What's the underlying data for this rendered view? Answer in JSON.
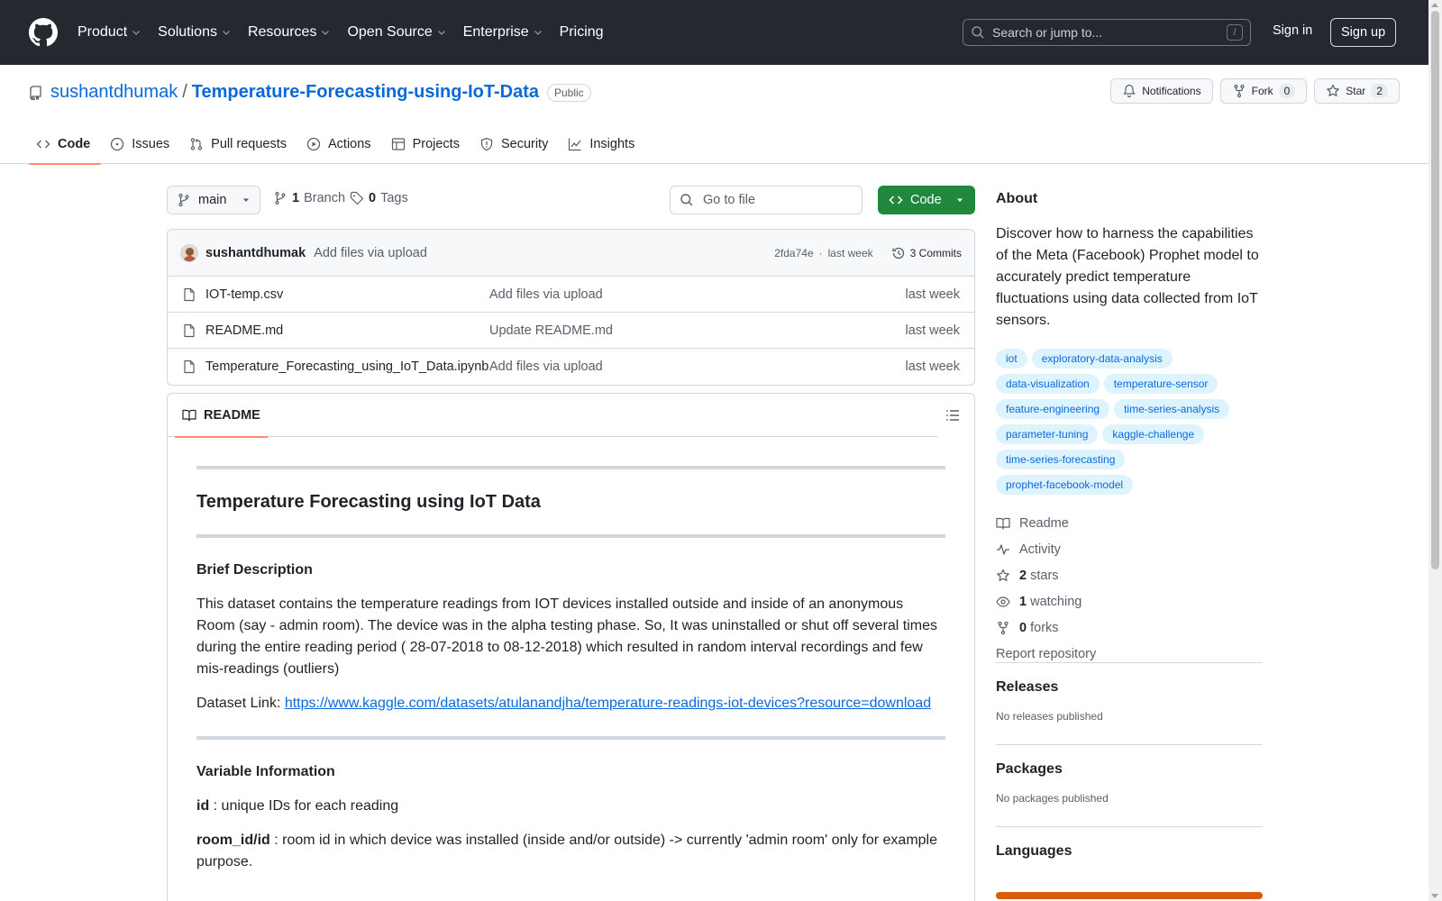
{
  "header": {
    "nav": [
      {
        "label": "Product",
        "dropdown": true
      },
      {
        "label": "Solutions",
        "dropdown": true
      },
      {
        "label": "Resources",
        "dropdown": true
      },
      {
        "label": "Open Source",
        "dropdown": true
      },
      {
        "label": "Enterprise",
        "dropdown": true
      },
      {
        "label": "Pricing",
        "dropdown": false
      }
    ],
    "search_placeholder": "Search or jump to...",
    "search_key": "/",
    "sign_in": "Sign in",
    "sign_up": "Sign up"
  },
  "repo": {
    "owner": "sushantdhumak",
    "separator": "/",
    "name": "Temperature-Forecasting-using-IoT-Data",
    "visibility": "Public",
    "notifications_label": "Notifications",
    "fork_label": "Fork",
    "fork_count": "0",
    "star_label": "Star",
    "star_count": "2"
  },
  "tabs": [
    {
      "label": "Code",
      "icon": "code-icon",
      "active": true
    },
    {
      "label": "Issues",
      "icon": "issue-icon",
      "active": false
    },
    {
      "label": "Pull requests",
      "icon": "pull-request-icon",
      "active": false
    },
    {
      "label": "Actions",
      "icon": "play-icon",
      "active": false
    },
    {
      "label": "Projects",
      "icon": "table-icon",
      "active": false
    },
    {
      "label": "Security",
      "icon": "shield-icon",
      "active": false
    },
    {
      "label": "Insights",
      "icon": "graph-icon",
      "active": false
    }
  ],
  "toolbar": {
    "branch": "main",
    "branch_count": "1",
    "branch_label": "Branch",
    "tag_count": "0",
    "tag_label": "Tags",
    "goto_placeholder": "Go to file",
    "code_button": "Code"
  },
  "commit": {
    "author": "sushantdhumak",
    "message": "Add files via upload",
    "hash": "2fda74e",
    "dot": "·",
    "time": "last week",
    "commits_label": "3 Commits"
  },
  "files": [
    {
      "name": "IOT-temp.csv",
      "message": "Add files via upload",
      "time": "last week"
    },
    {
      "name": "README.md",
      "message": "Update README.md",
      "time": "last week"
    },
    {
      "name": "Temperature_Forecasting_using_IoT_Data.ipynb",
      "message": "Add files via upload",
      "time": "last week"
    }
  ],
  "readme": {
    "tab_label": "README",
    "title": "Temperature Forecasting using IoT Data",
    "brief_heading": "Brief Description",
    "brief_text": "This dataset contains the temperature readings from IOT devices installed outside and inside of an anonymous Room (say - admin room). The device was in the alpha testing phase. So, It was uninstalled or shut off several times during the entire reading period ( 28-07-2018 to 08-12-2018) which resulted in random interval recordings and few mis-readings (outliers)",
    "dataset_label": "Dataset Link: ",
    "dataset_url": "https://www.kaggle.com/datasets/atulanandjha/temperature-readings-iot-devices?resource=download",
    "variable_heading": "Variable Information",
    "var_id_name": "id",
    "var_id_desc": " : unique IDs for each reading",
    "var_room_name": "room_id/id",
    "var_room_desc": " : room id in which device was installed (inside and/or outside) -> currently 'admin room' only for example purpose."
  },
  "about": {
    "heading": "About",
    "description": "Discover how to harness the capabilities of the Meta (Facebook) Prophet model to accurately predict temperature fluctuations using data collected from IoT sensors.",
    "topics": [
      "iot",
      "exploratory-data-analysis",
      "data-visualization",
      "temperature-sensor",
      "feature-engineering",
      "time-series-analysis",
      "parameter-tuning",
      "kaggle-challenge",
      "time-series-forecasting",
      "prophet-facebook-model"
    ],
    "readme": "Readme",
    "activity": "Activity",
    "stars_count": "2",
    "stars_label": "stars",
    "watching_count": "1",
    "watching_label": "watching",
    "forks_count": "0",
    "forks_label": "forks",
    "report": "Report repository"
  },
  "releases": {
    "heading": "Releases",
    "text": "No releases published"
  },
  "packages": {
    "heading": "Packages",
    "text": "No packages published"
  },
  "languages": {
    "heading": "Languages",
    "bar_color": "#DA5B0B"
  }
}
